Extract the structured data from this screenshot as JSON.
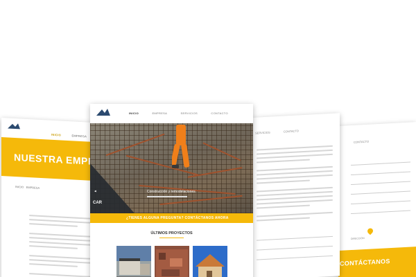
{
  "colors": {
    "accent": "#f5b90a",
    "dark": "#262a30"
  },
  "left_page": {
    "nav": {
      "active": "INICIO",
      "item2": "EMPRESA"
    },
    "banner_title": "NUESTRA EMPRESA",
    "breadcrumb": {
      "home": "INICIO",
      "current": "EMPRESA"
    }
  },
  "center_page": {
    "nav": {
      "active": "INICIO",
      "item2": "EMPRESA",
      "item3": "SERVICIOS",
      "item4": "CONTACTO"
    },
    "hero": {
      "caption": "Construcción y remodelaciones"
    },
    "cta_text": "¿TIENES ALGUNA PREGUNTA? CONTÁCTANOS AHORA",
    "section_title": "ÚLTIMOS PROYECTOS",
    "logo_text": "CAR"
  },
  "midright_page": {
    "nav": {
      "item1": "SERVICIOS",
      "item2": "CONTACTO"
    }
  },
  "right_page": {
    "nav": {
      "item1": "CONTACTO"
    },
    "small_label": "DIRECCIÓN",
    "banner_title": "CONTÁCTANOS"
  }
}
